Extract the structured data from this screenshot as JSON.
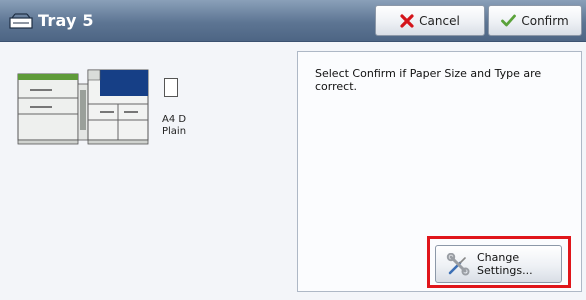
{
  "window": {
    "title": "Tray 5",
    "title_icon": "tray-icon"
  },
  "toolbar": {
    "cancel_label": "Cancel",
    "cancel_icon": "red-x-icon",
    "confirm_label": "Confirm",
    "confirm_icon": "green-check-icon"
  },
  "tray_status": {
    "paper_size": "A4 D",
    "paper_type": "Plain"
  },
  "info_panel": {
    "message": "Select Confirm if Paper Size and Type are correct.",
    "change_settings_label": "Change\nSettings...",
    "change_settings_icon": "wrench-screwdriver-icon"
  },
  "colors": {
    "titlebar": "#5d7593",
    "highlight": "#e0161b",
    "machine_accent_blue": "#163f86",
    "machine_accent_green": "#5f9b3a"
  }
}
